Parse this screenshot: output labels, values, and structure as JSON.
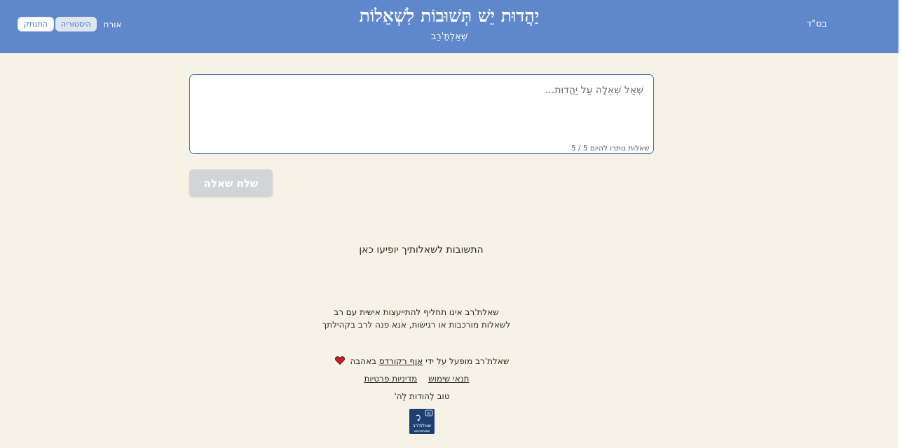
{
  "header": {
    "title": "יַהֲדוּת יֵשׁ תְּשׁוּבוֹת לִשְׁאֵלוֹת",
    "subtitle": "שְׁאַלְתָּ'רַב",
    "bsd": "בס\"ד",
    "guest_label": "אורח",
    "history_button": "היסטוריה",
    "logout_button": "התנתק",
    "colors": {
      "header_bg": "#5f87cc",
      "page_bg": "#f6f2e6"
    }
  },
  "question": {
    "placeholder": "שְׁאַל שְׁאֵלָה עַל יַהֲדוּת...",
    "value": "",
    "counter": "שאלות נותרו להיום 5 / 5"
  },
  "send_button": "שלח שאלה",
  "answers_placeholder": "התשובות לשאלותיך יופיעו כאן",
  "disclaimer": {
    "line1": "שאלת'רב אינו תחליף להתייעצות אישית עם רב",
    "line2": "לשאלות מורכבות או רגישות, אנא פנה לרב בקהילתך"
  },
  "footer": {
    "powered_prefix": "שאלת'רב מופעל על ידי",
    "powered_link": "אָוָף רקורדס",
    "powered_suffix": "באהבה",
    "terms_link": "תנאי שימוש",
    "privacy_link": "מדיניות פרטיות",
    "thanks": "טוב לְהודות לַה'",
    "logo_text": "שאלת'רב",
    "logo_badge": "AI",
    "logo_subtext": "ASKTHERABBI"
  },
  "icons": {
    "heart": "heart-icon",
    "logo": "asktherabbi-logo-icon"
  }
}
